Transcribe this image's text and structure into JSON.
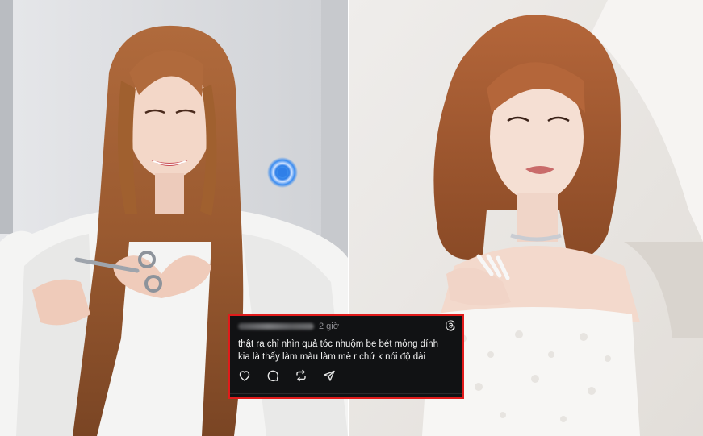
{
  "photos": {
    "left": {
      "icon": "touch-indicator-icon"
    },
    "right": {}
  },
  "comment": {
    "timestamp": "2 giờ",
    "lines": [
      "thật ra chỉ nhìn quả tóc nhuộm be bét mỏng dính",
      "kia là thấy làm màu làm mè r chứ k nói độ dài"
    ],
    "icons": {
      "brand": "threads-icon",
      "like": "heart-icon",
      "reply": "comment-icon",
      "repost": "repost-icon",
      "share": "send-icon"
    },
    "colors": {
      "border": "#e11b1b",
      "background": "#111214",
      "text": "#f4f4f4",
      "muted": "#8e8e93"
    }
  }
}
